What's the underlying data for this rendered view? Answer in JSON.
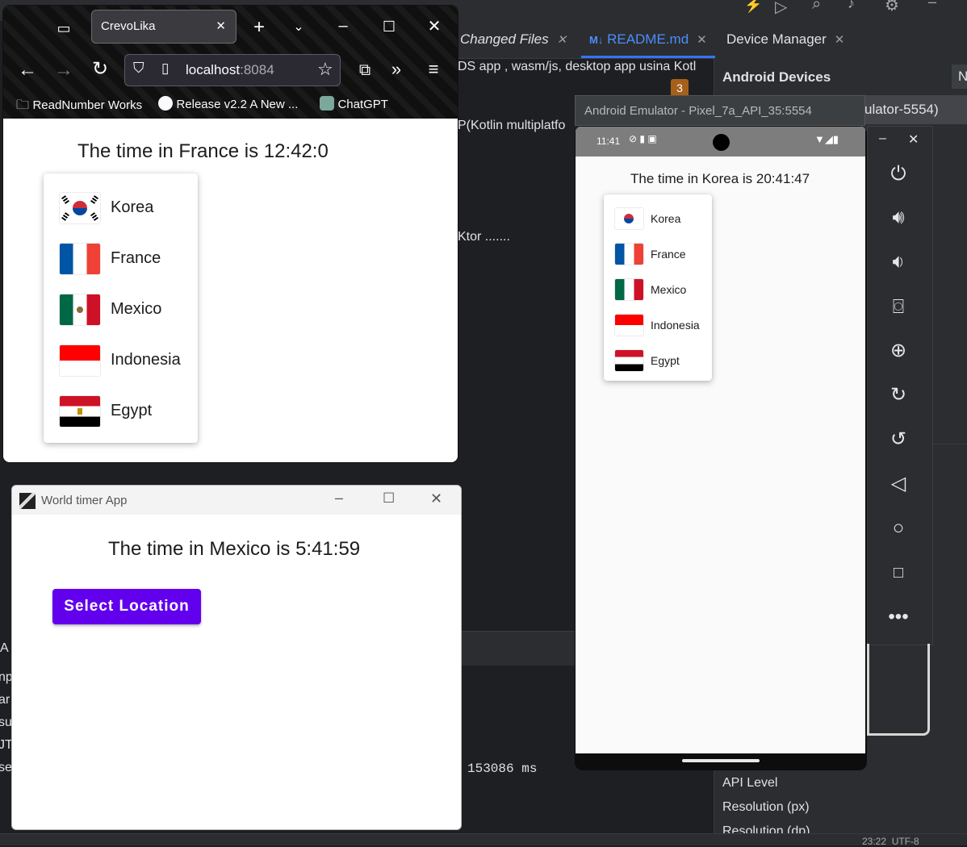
{
  "ide": {
    "tabs": [
      {
        "label": "Changed Files"
      },
      {
        "label": "README.md",
        "prefix": "M↓"
      },
      {
        "label": "Device Manager"
      }
    ],
    "editor_lines": [
      "DS app , wasm/js, desktop app usina Kotl",
      "P(Kotlin multiplatfo",
      "Ktor ......."
    ],
    "badge_count": "3",
    "device_manager": {
      "heading": "Android Devices",
      "device_fragment": "ulator-5554)",
      "props": [
        "API Level",
        "Resolution (px)",
        "Resolution (dp)"
      ]
    },
    "terminal_text": "153086 ms",
    "left_fragments": [
      "A",
      "np",
      "ar",
      "su",
      "JT",
      "se"
    ],
    "status_fragment": "23:22  UTF-8"
  },
  "browser": {
    "tab_title": "CrevoLika",
    "url_host": "localhost",
    "url_port": ":8084",
    "bookmarks": [
      "ReadNumber Works",
      "Release v2.2 A New ...",
      "ChatGPT"
    ],
    "page": {
      "time_text": "The time in France is 12:42:0",
      "countries": [
        "Korea",
        "France",
        "Mexico",
        "Indonesia",
        "Egypt"
      ]
    }
  },
  "desktop_app": {
    "title": "World timer App",
    "time_text": "The time in Mexico is 5:41:59",
    "button_label": "Select Location"
  },
  "emulator": {
    "title": "Android Emulator - Pixel_7a_API_35:5554",
    "clock": "11:41",
    "time_text": "The time in Korea is 20:41:47",
    "countries": [
      "Korea",
      "France",
      "Mexico",
      "Indonesia",
      "Egypt"
    ]
  },
  "colors": {
    "primary_button": "#6200ee",
    "ide_background": "#1e1f22",
    "ide_accent": "#3574f0"
  }
}
